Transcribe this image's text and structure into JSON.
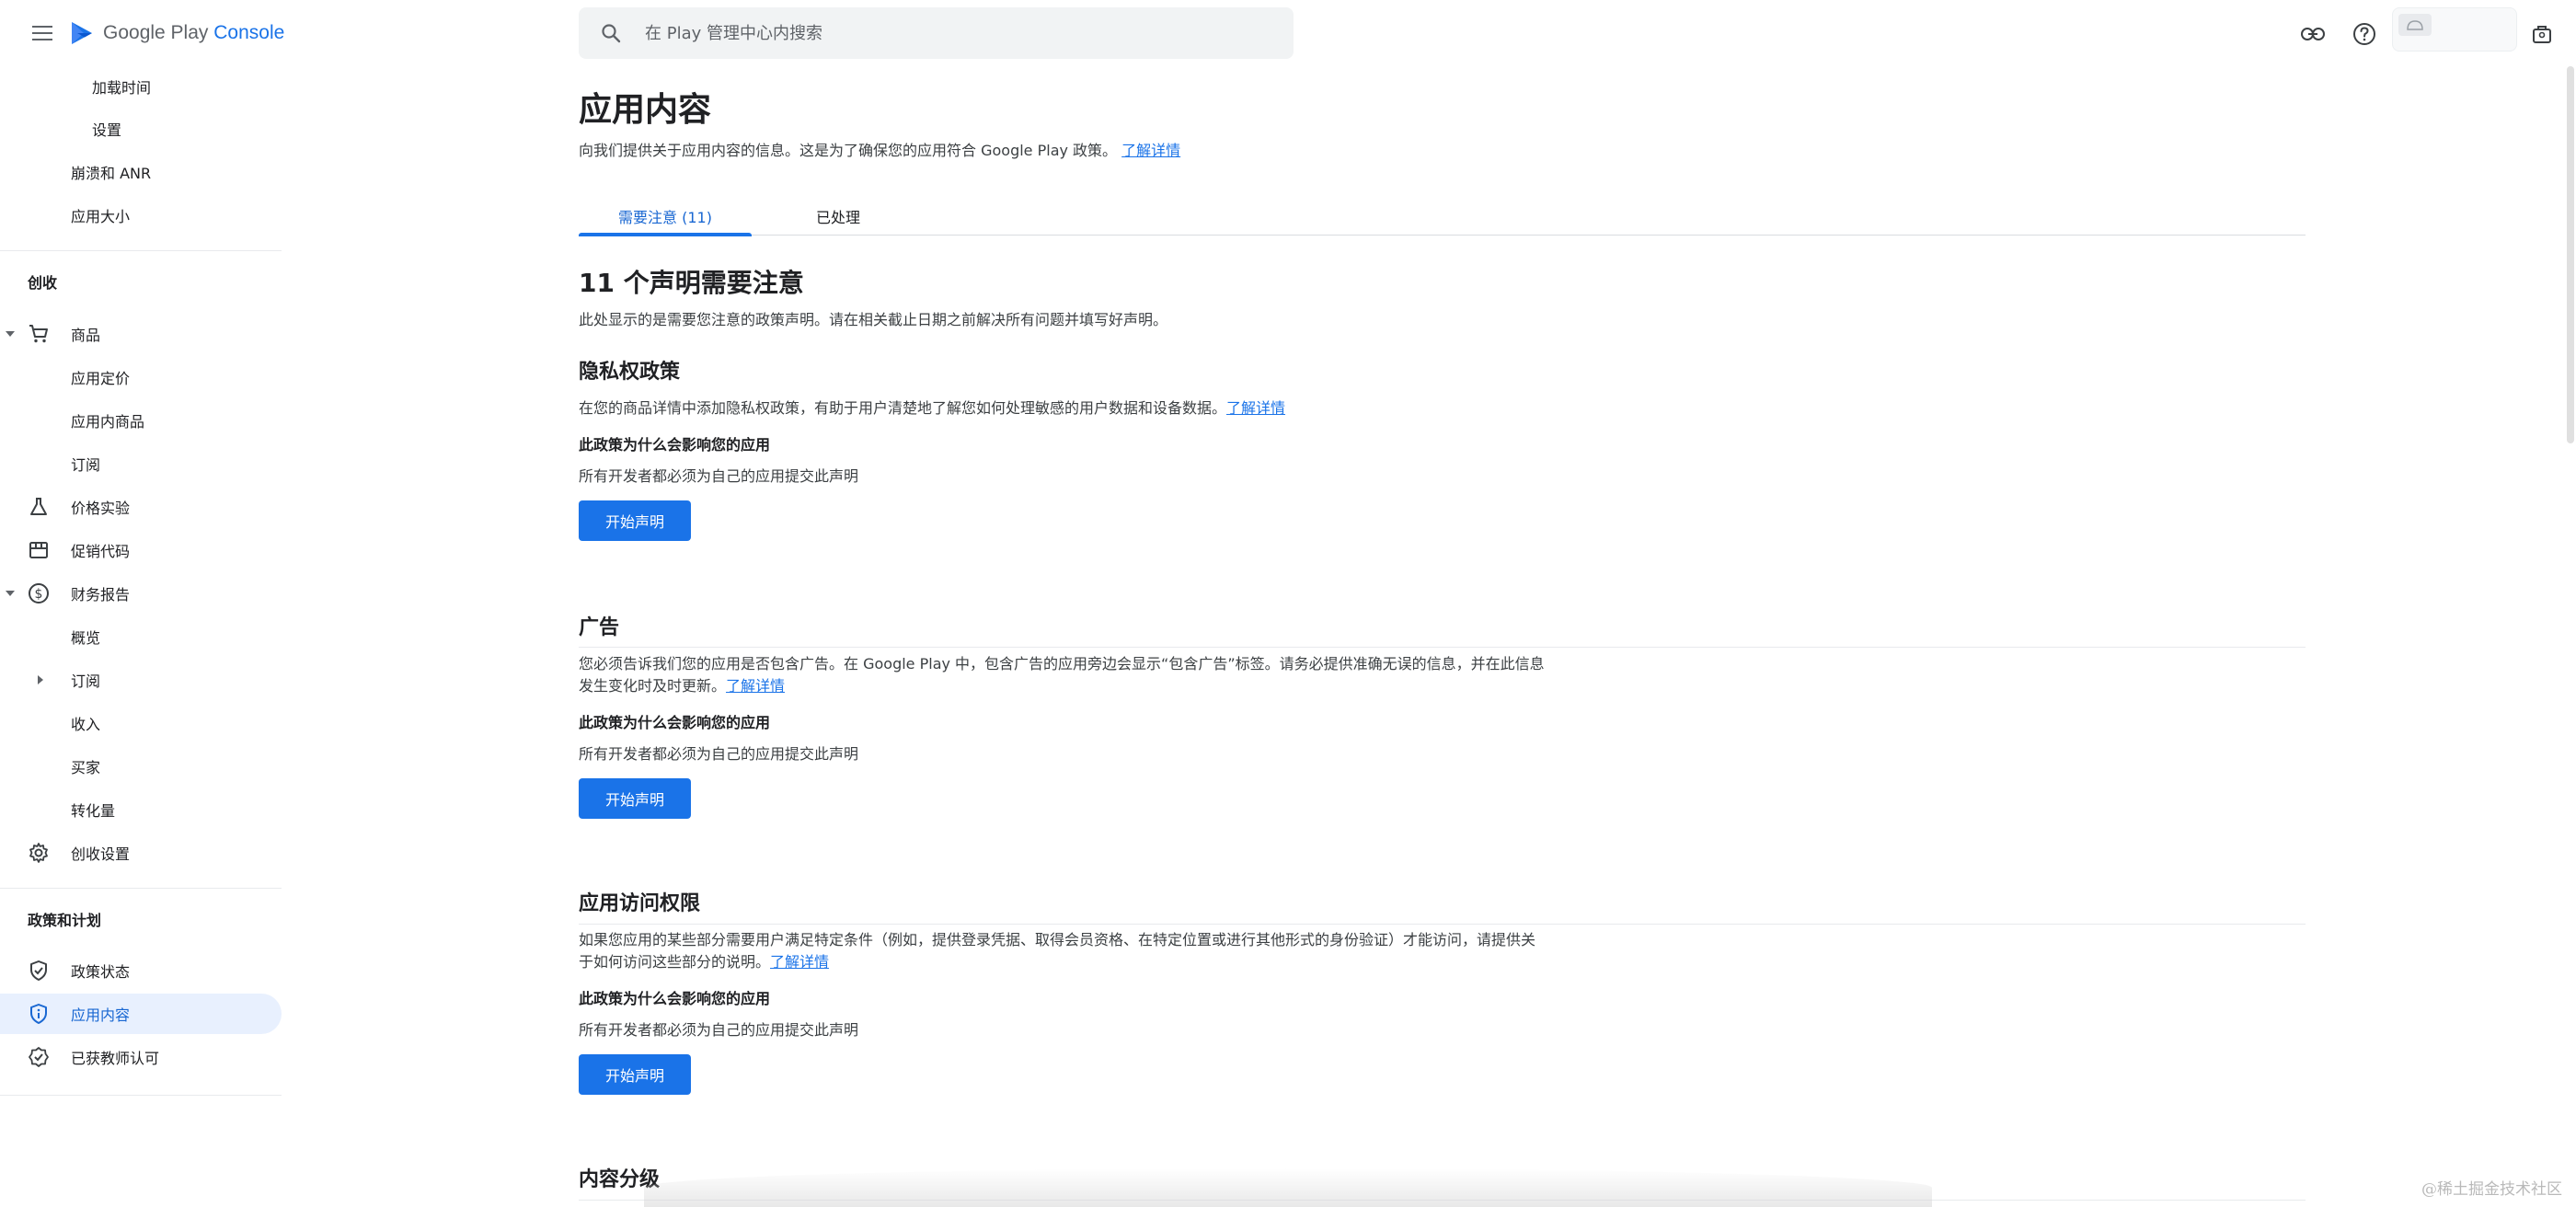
{
  "app": {
    "brand_prefix": "Google Play",
    "brand_suffix": "Console"
  },
  "search": {
    "placeholder": "在 Play 管理中心内搜索"
  },
  "sidebar": {
    "items": [
      {
        "label": "加载时间"
      },
      {
        "label": "设置"
      },
      {
        "label": "崩溃和 ANR"
      },
      {
        "label": "应用大小"
      }
    ],
    "sections": [
      {
        "title": "创收"
      },
      {
        "title": "政策和计划"
      }
    ],
    "monetize": [
      {
        "label": "商品"
      },
      {
        "label": "应用定价"
      },
      {
        "label": "应用内商品"
      },
      {
        "label": "订阅"
      },
      {
        "label": "价格实验"
      },
      {
        "label": "促销代码"
      },
      {
        "label": "财务报告"
      },
      {
        "label": "概览"
      },
      {
        "label": "订阅"
      },
      {
        "label": "收入"
      },
      {
        "label": "买家"
      },
      {
        "label": "转化量"
      },
      {
        "label": "创收设置"
      }
    ],
    "policy": [
      {
        "label": "政策状态"
      },
      {
        "label": "应用内容"
      },
      {
        "label": "已获教师认可"
      }
    ]
  },
  "main": {
    "title": "应用内容",
    "description": "向我们提供关于应用内容的信息。这是为了确保您的应用符合 Google Play 政策。",
    "learn_more": "了解详情",
    "tabs": [
      {
        "label": "需要注意 (11)"
      },
      {
        "label": "已处理"
      }
    ],
    "issues_title": "11 个声明需要注意",
    "issues_desc": "此处显示的是需要您注意的政策声明。请在相关截止日期之前解决所有问题并填写好声明。",
    "declarations": [
      {
        "title": "隐私权政策",
        "description": "在您的商品详情中添加隐私权政策，有助于用户清楚地了解您如何处理敏感的用户数据和设备数据。",
        "learn_more": "了解详情",
        "affect_title": "此政策为什么会影响您的应用",
        "affect_text": "所有开发者都必须为自己的应用提交此声明",
        "button": "开始声明"
      },
      {
        "title": "广告",
        "description": "您必须告诉我们您的应用是否包含广告。在 Google Play 中，包含广告的应用旁边会显示“包含广告”标签。请务必提供准确无误的信息，并在此信息发生变化时及时更新。",
        "learn_more": "了解详情",
        "affect_title": "此政策为什么会影响您的应用",
        "affect_text": "所有开发者都必须为自己的应用提交此声明",
        "button": "开始声明"
      },
      {
        "title": "应用访问权限",
        "description": "如果您应用的某些部分需要用户满足特定条件（例如，提供登录凭据、取得会员资格、在特定位置或进行其他形式的身份验证）才能访问，请提供关于如何访问这些部分的说明。",
        "learn_more": "了解详情",
        "affect_title": "此政策为什么会影响您的应用",
        "affect_text": "所有开发者都必须为自己的应用提交此声明",
        "button": "开始声明"
      },
      {
        "title": "内容分级"
      }
    ]
  },
  "watermark": "@稀土掘金技术社区",
  "colors": {
    "accent": "#1a73e8",
    "active_bg": "#e8f0fe",
    "divider": "#e8eaed"
  }
}
